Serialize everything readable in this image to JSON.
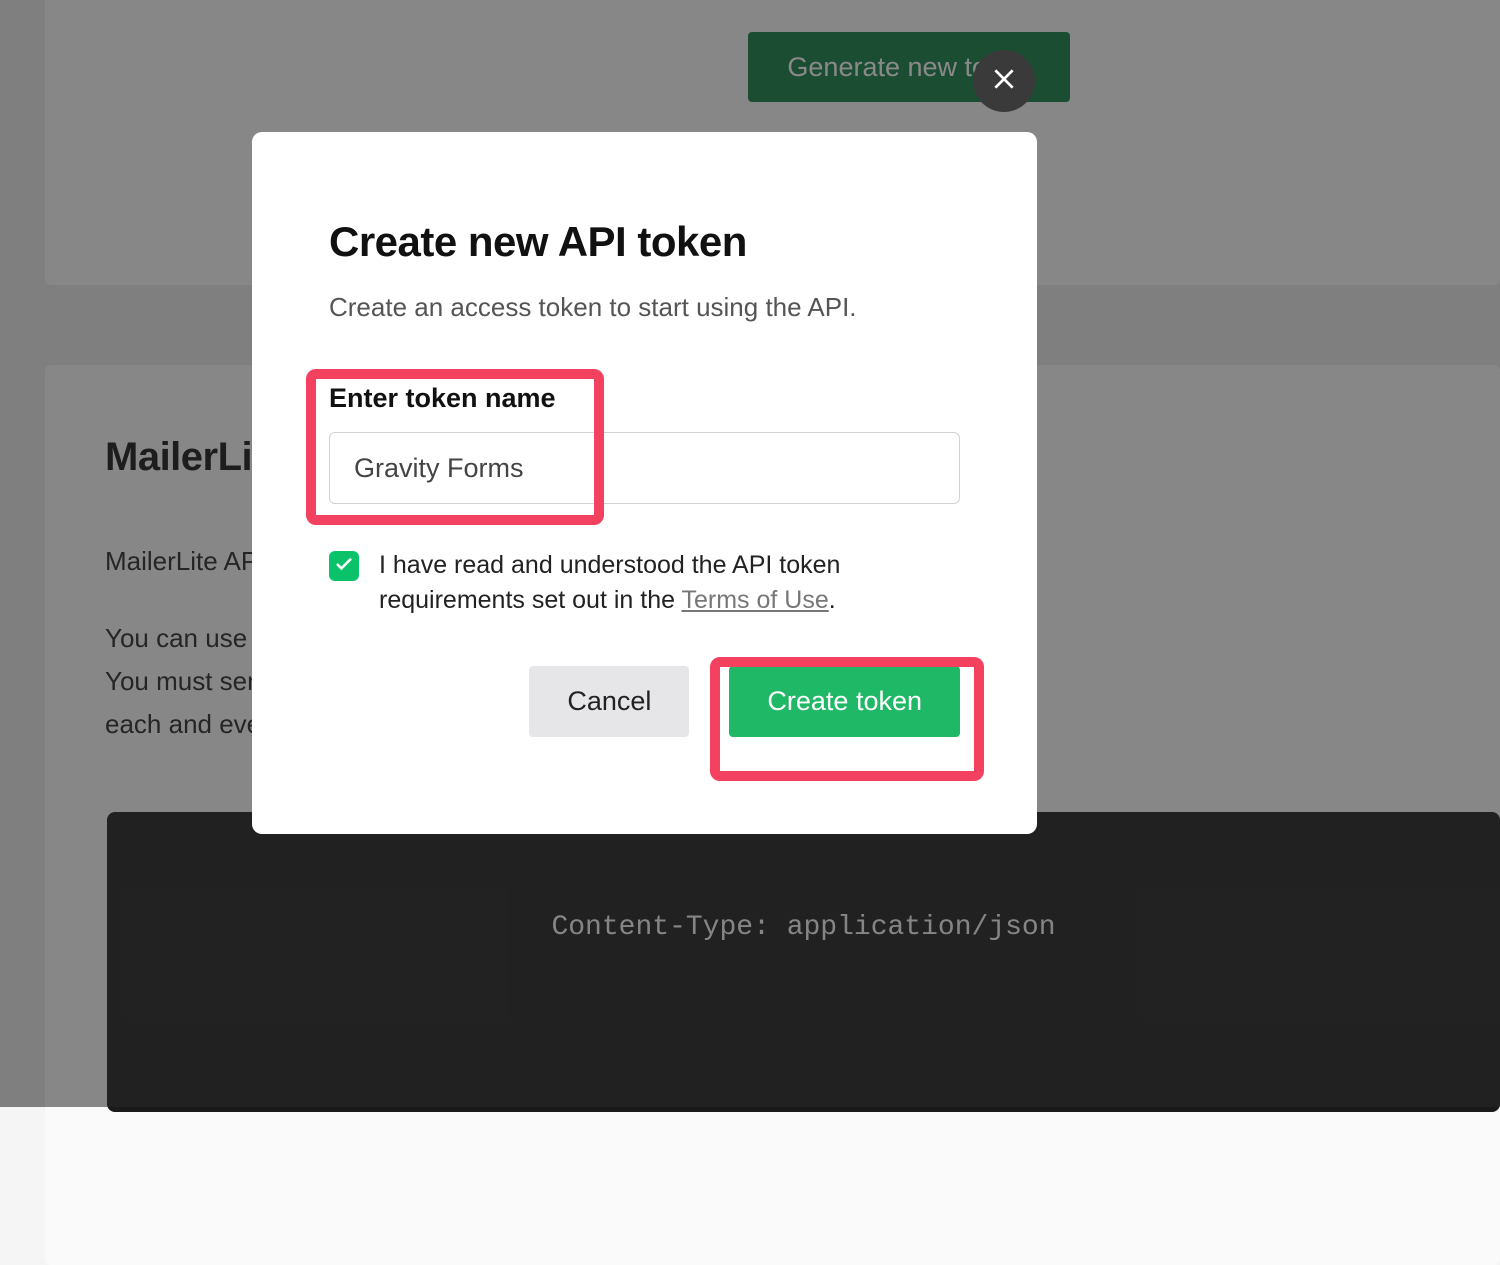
{
  "background": {
    "generate_button_label": "Generate new token",
    "section_heading": "MailerLite API",
    "para1": "MailerLite API",
    "para2_line1": "You can use any standard HTTPS client or library in any programming language.",
    "para2_line2": "You must send JSON-encoded requests and handle JSON responses. Don't",
    "para2_line3": "each and every",
    "code_line": "Content-Type: application/json"
  },
  "modal": {
    "title": "Create new API token",
    "subtitle": "Create an access token to start using the API.",
    "token_name_label": "Enter token name",
    "token_name_value": "Gravity Forms",
    "consent_prefix": "I have read and understood the API token requirements set out in the ",
    "consent_terms": "Terms of Use",
    "consent_suffix": ".",
    "consent_checked": true,
    "cancel_label": "Cancel",
    "create_label": "Create token"
  }
}
